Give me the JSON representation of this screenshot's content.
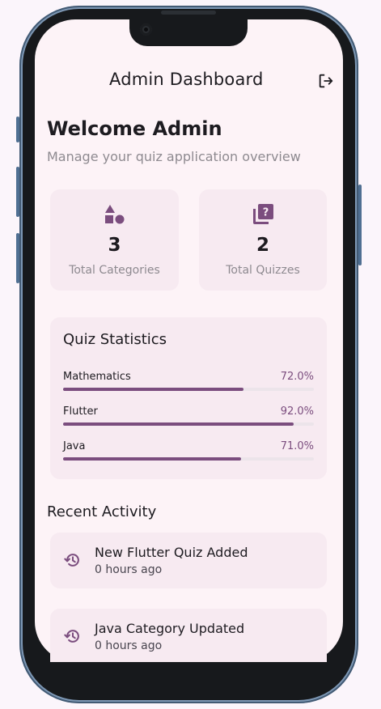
{
  "app_bar": {
    "title": "Admin Dashboard",
    "action_icon": "logout-icon"
  },
  "header": {
    "welcome": "Welcome Admin",
    "subtitle": "Manage your quiz application overview"
  },
  "stats": [
    {
      "icon": "category-shapes-icon",
      "value": "3",
      "label": "Total Categories"
    },
    {
      "icon": "quiz-icon",
      "value": "2",
      "label": "Total Quizzes"
    }
  ],
  "quiz_statistics": {
    "title": "Quiz Statistics",
    "items": [
      {
        "name": "Mathematics",
        "percent_text": "72.0%",
        "progress": 0.72
      },
      {
        "name": "Flutter",
        "percent_text": "92.0%",
        "progress": 0.92
      },
      {
        "name": "Java",
        "percent_text": "71.0%",
        "progress": 0.71
      }
    ]
  },
  "recent_activity": {
    "title": "Recent Activity",
    "items": [
      {
        "icon": "history-icon",
        "title": "New Flutter Quiz Added",
        "time": "0 hours ago"
      },
      {
        "icon": "history-icon",
        "title": "Java Category Updated",
        "time": "0 hours ago"
      }
    ]
  },
  "colors": {
    "accent": "#7b4d7e",
    "card": "#f7eaf1",
    "background": "#fdf3f7"
  }
}
